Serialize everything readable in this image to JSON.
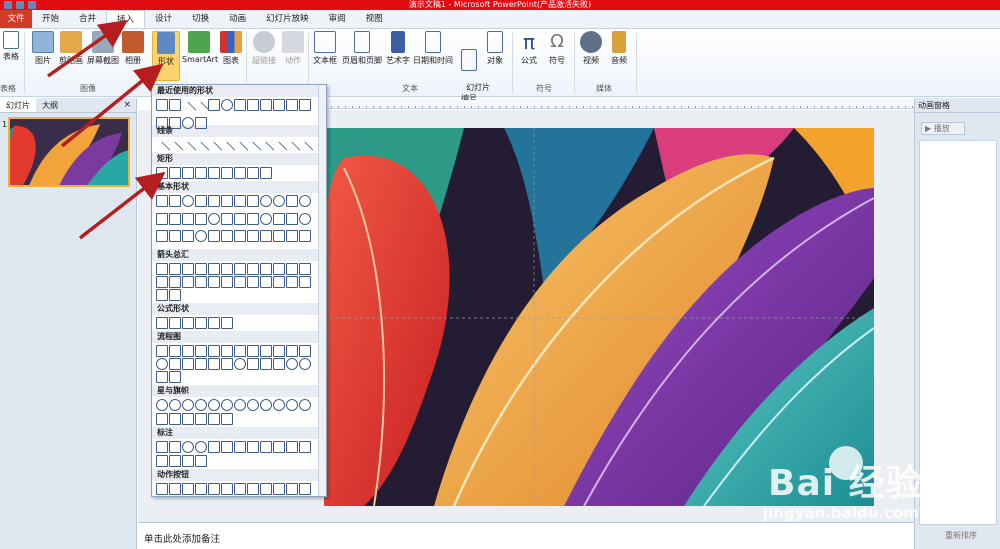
{
  "window": {
    "title": "演示文稿1 - Microsoft PowerPoint(产品激活失败)"
  },
  "tabs": [
    {
      "label": "文件"
    },
    {
      "label": "开始"
    },
    {
      "label": "合并"
    },
    {
      "label": "插入"
    },
    {
      "label": "设计"
    },
    {
      "label": "切换"
    },
    {
      "label": "动画"
    },
    {
      "label": "幻灯片放映"
    },
    {
      "label": "审阅"
    },
    {
      "label": "视图"
    }
  ],
  "ribbon": {
    "buttons": {
      "table": "表格",
      "picture": "图片",
      "clipart": "剪贴画",
      "screenshot": "屏幕截图",
      "album": "相册",
      "shapes": "形状",
      "smartart": "SmartArt",
      "chart": "图表",
      "hyperlink": "超链接",
      "action": "动作",
      "textbox": "文本框",
      "headerfooter": "页眉和页脚",
      "wordart": "艺术字",
      "datetime": "日期和时间",
      "slidenum": "幻灯片\n编号",
      "object": "对象",
      "equation": "公式",
      "symbol": "符号",
      "video": "视频",
      "audio": "音频"
    },
    "groups": {
      "tables": "表格",
      "images": "图像",
      "text": "文本",
      "symbols": "符号",
      "media": "媒体"
    }
  },
  "left_pane": {
    "tab_slides": "幻灯片",
    "tab_outline": "大纲",
    "close": "×",
    "slide_number": "1"
  },
  "shapes_menu": {
    "sections": [
      "最近使用的形状",
      "线条",
      "矩形",
      "基本形状",
      "箭头总汇",
      "公式形状",
      "流程图",
      "星与旗帜",
      "标注",
      "动作按钮"
    ]
  },
  "right_pane": {
    "title": "动画窗格",
    "play": "▶ 播放",
    "reorder": "重新排序"
  },
  "notes": {
    "placeholder": "单击此处添加备注"
  },
  "watermark": {
    "brand": "Bai  经验",
    "url": "jingyan.baidu.com"
  },
  "colors": {
    "titlebar": "#e20d13",
    "file_tab": "#d13c26",
    "selected_button": "#fbd46b",
    "annotation_arrow": "#b51e1e"
  }
}
